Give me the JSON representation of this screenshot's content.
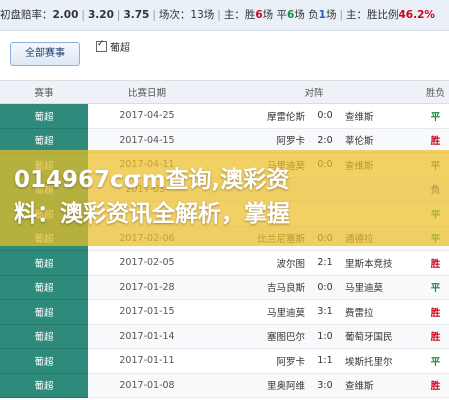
{
  "summary": {
    "odds_label": "初盘赔率：",
    "odds_home": "2.00",
    "odds_draw": "3.20",
    "odds_away": "3.75",
    "matches_label": "场次：",
    "matches_count": "13",
    "matches_unit": "场",
    "record_label": "主：胜",
    "wins": "6",
    "win_unit": "场 平",
    "draws": "6",
    "draw_unit": "场 负",
    "losses": "1",
    "loss_unit": "场",
    "ratio_label": "主：胜比例",
    "win_ratio": "46.2%"
  },
  "filter": {
    "all_button": "全部赛事",
    "league_checkbox": "葡超"
  },
  "table": {
    "headers": [
      "赛事",
      "比赛日期",
      "对阵",
      "胜负"
    ],
    "rows": [
      {
        "league": "葡超",
        "date": "2017-04-25",
        "home": "摩雷伦斯",
        "score": "0:0",
        "away": "查维斯",
        "result": "平",
        "type": "draw"
      },
      {
        "league": "葡超",
        "date": "2017-04-15",
        "home": "阿罗卡",
        "score": "2:0",
        "away": "莘伦斯",
        "result": "胜",
        "type": "win"
      },
      {
        "league": "葡超",
        "date": "2017-04-11",
        "home": "马里迪莫",
        "score": "0:0",
        "away": "查维斯",
        "result": "平",
        "type": "draw"
      },
      {
        "league": "葡超",
        "date": "2017-03-",
        "home": "",
        "score": "",
        "away": "",
        "result": "负",
        "type": "lose"
      },
      {
        "league": "葡超",
        "date": "",
        "home": "",
        "score": "",
        "away": "",
        "result": "平",
        "type": "draw"
      },
      {
        "league": "葡超",
        "date": "2017-02-06",
        "home": "比兰尼塞斯",
        "score": "0:0",
        "away": "通德拉",
        "result": "平",
        "type": "draw"
      },
      {
        "league": "葡超",
        "date": "2017-02-05",
        "home": "波尔图",
        "score": "2:1",
        "away": "里斯本竞技",
        "result": "胜",
        "type": "win"
      },
      {
        "league": "葡超",
        "date": "2017-01-28",
        "home": "吉马良斯",
        "score": "0:0",
        "away": "马里迪莫",
        "result": "平",
        "type": "draw"
      },
      {
        "league": "葡超",
        "date": "2017-01-15",
        "home": "马里迪莫",
        "score": "3:1",
        "away": "费雷拉",
        "result": "胜",
        "type": "win"
      },
      {
        "league": "葡超",
        "date": "2017-01-14",
        "home": "塞图巴尔",
        "score": "1:0",
        "away": "葡萄牙国民",
        "result": "胜",
        "type": "win"
      },
      {
        "league": "葡超",
        "date": "2017-01-11",
        "home": "阿罗卡",
        "score": "1:1",
        "away": "埃斯托里尔",
        "result": "平",
        "type": "draw"
      },
      {
        "league": "葡超",
        "date": "2017-01-08",
        "home": "里奥阿维",
        "score": "3:0",
        "away": "查维斯",
        "result": "胜",
        "type": "win"
      }
    ]
  },
  "banner": {
    "line1": "014967cσm查询,澳彩资",
    "line2": "料：澳彩资讯全解析，掌握"
  }
}
